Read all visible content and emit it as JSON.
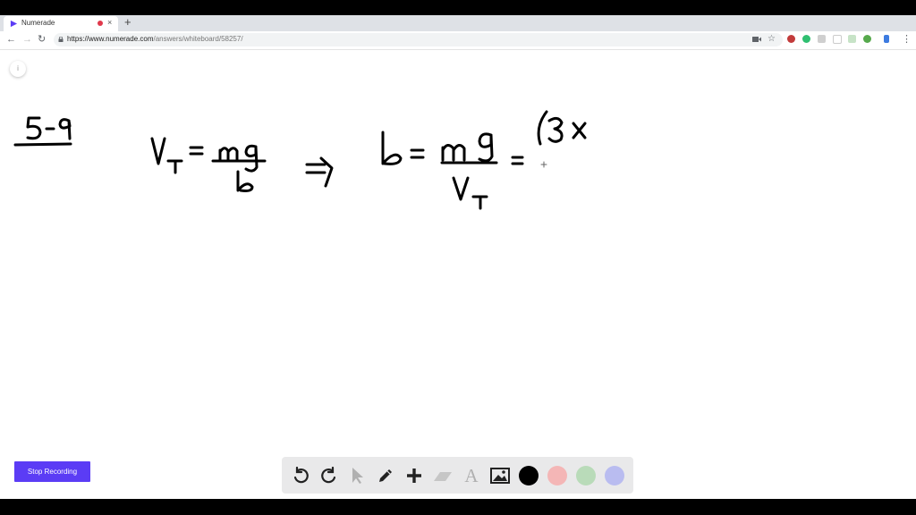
{
  "browser": {
    "tab_title": "Numerade",
    "tab_close": "×",
    "new_tab": "+",
    "url_host": "https://www.numerade.com",
    "url_path": "/answers/whiteboard/58257/",
    "icons": [
      "back-icon",
      "forward-icon",
      "reload-icon",
      "lock-icon",
      "star-icon",
      "menu-icon"
    ]
  },
  "page": {
    "info_label": "i",
    "stop_recording_label": "Stop Recording"
  },
  "whiteboard": {
    "handwriting": [
      "5-9",
      "V_T = mg / b",
      "⇒",
      "b = mg / V_T = (3x"
    ]
  },
  "tools": {
    "items": [
      "undo-icon",
      "redo-icon",
      "select-icon",
      "pen-icon",
      "add-icon",
      "eraser-icon",
      "text-icon",
      "image-icon"
    ],
    "text_tool_label": "A",
    "colors": [
      "#000000",
      "#f4b6b6",
      "#b9dbb9",
      "#b9bcf0"
    ]
  }
}
